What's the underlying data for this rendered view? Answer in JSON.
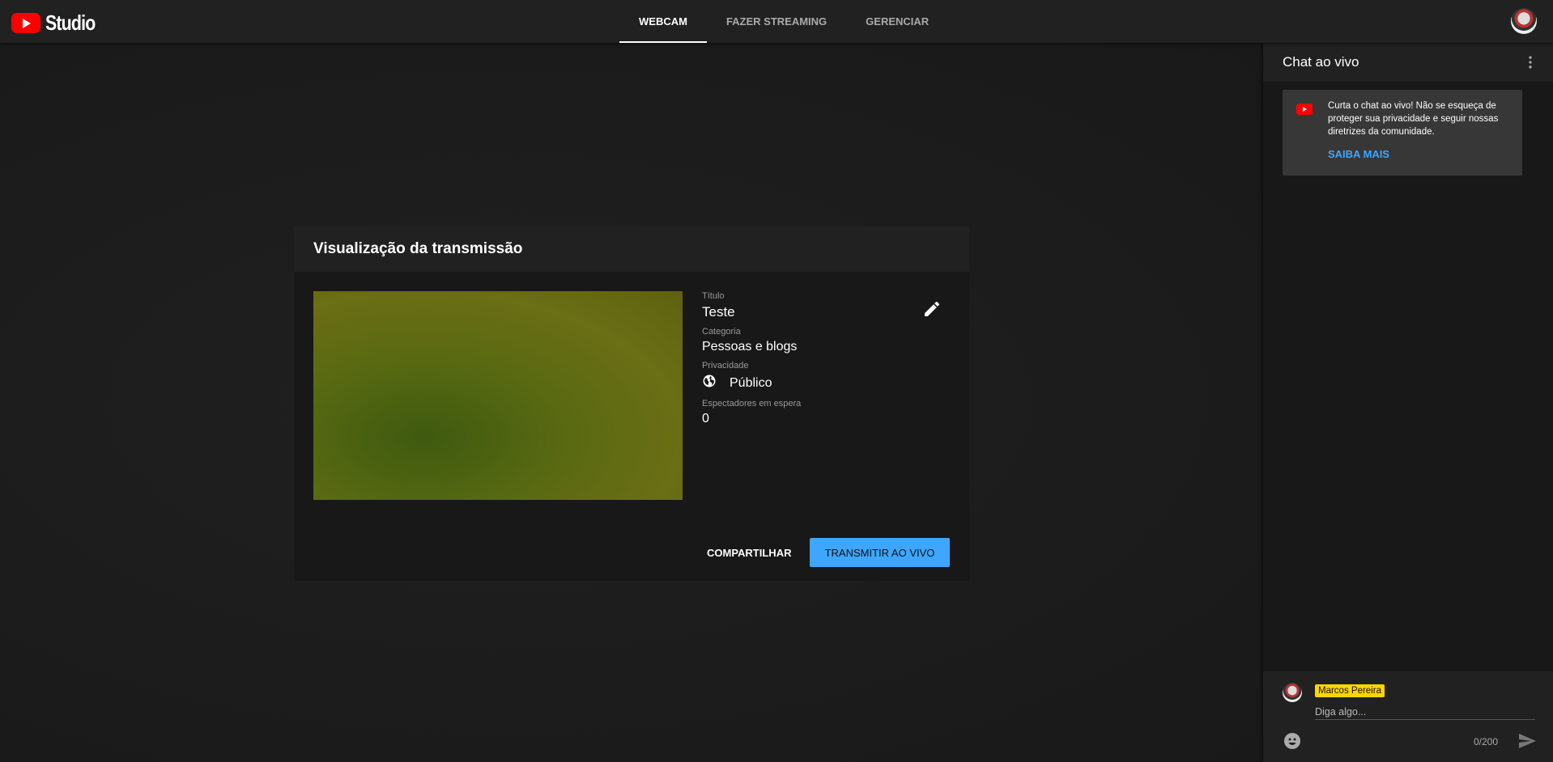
{
  "app": {
    "logo_text": "Studio"
  },
  "tabs": [
    {
      "label": "WEBCAM",
      "active": true
    },
    {
      "label": "FAZER STREAMING",
      "active": false
    },
    {
      "label": "GERENCIAR",
      "active": false
    }
  ],
  "card": {
    "title": "Visualização da transmissão",
    "fields": {
      "title_label": "Título",
      "title_value": "Teste",
      "category_label": "Categoria",
      "category_value": "Pessoas e blogs",
      "privacy_label": "Privacidade",
      "privacy_value": "Público",
      "waiting_label": "Espectadores em espera",
      "waiting_value": "0"
    },
    "share_label": "COMPARTILHAR",
    "go_live_label": "TRANSMITIR AO VIVO"
  },
  "chat": {
    "title": "Chat ao vivo",
    "notice_text": "Curta o chat ao vivo! Não se esqueça de proteger sua privacidade e seguir nossas diretrizes da comunidade.",
    "notice_link": "SAIBA MAIS",
    "author_name": "Marcos Pereira",
    "input_placeholder": "Diga algo...",
    "char_counter": "0/200"
  },
  "colors": {
    "accent": "#3ea6ff",
    "brand": "#ff0000",
    "author_badge": "#ffd600"
  }
}
